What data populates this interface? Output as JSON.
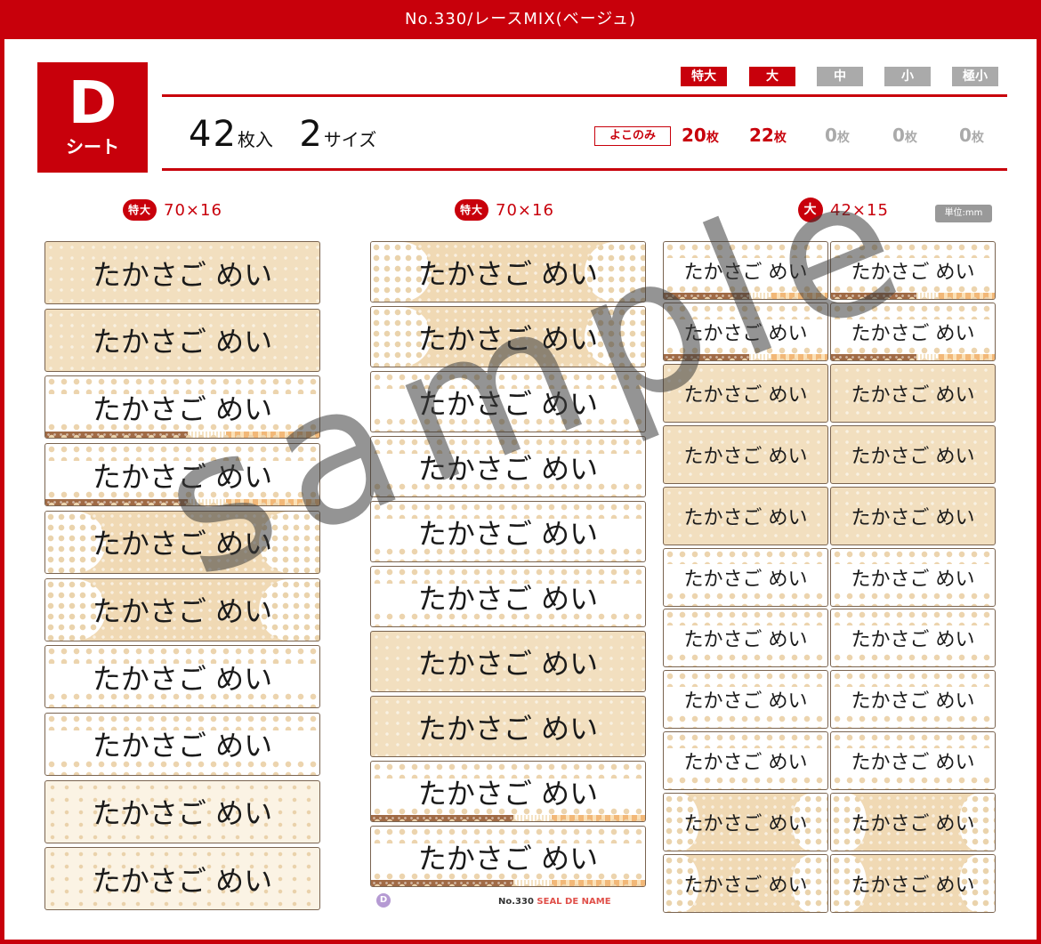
{
  "title": "No.330/レースMIX(ベージュ)",
  "sheet": {
    "letter": "D",
    "word": "シート"
  },
  "sizes": [
    {
      "label": "特大",
      "active": true
    },
    {
      "label": "大",
      "active": true
    },
    {
      "label": "中",
      "active": false
    },
    {
      "label": "小",
      "active": false
    },
    {
      "label": "極小",
      "active": false
    }
  ],
  "summary": {
    "count_num": "42",
    "count_unit": "枚入",
    "sizes_num": "2",
    "sizes_unit": "サイズ"
  },
  "yoko_label": "よこのみ",
  "piece_counts": [
    {
      "num": "20",
      "unit": "枚"
    },
    {
      "num": "22",
      "unit": "枚"
    },
    {
      "num": "0",
      "unit": "枚"
    },
    {
      "num": "0",
      "unit": "枚"
    },
    {
      "num": "0",
      "unit": "枚"
    }
  ],
  "columns": [
    {
      "badge": "特大",
      "dims": "70×16"
    },
    {
      "badge": "特大",
      "dims": "70×16"
    },
    {
      "badge": "大",
      "dims": "42×15"
    }
  ],
  "unit_label": "単位:mm",
  "name": "たかさご めい",
  "watermark": "sample",
  "footer": {
    "badge": "D",
    "model": "No.330",
    "brand": "SEAL DE NAME"
  },
  "colors": {
    "accent": "#c8000b",
    "inactive": "#aaaaaa",
    "beige": "#f2dfbf",
    "brown": "#a06a45"
  },
  "label_patterns": {
    "col1": [
      "beige",
      "beige",
      "white-stripe",
      "white-stripe",
      "lace-side",
      "lace-side",
      "white",
      "white",
      "dots",
      "dots"
    ],
    "col2": [
      "lace-side",
      "lace-side",
      "white",
      "white",
      "white",
      "white",
      "beige",
      "beige",
      "white-stripe",
      "white-stripe"
    ],
    "col3": [
      "white-stripe",
      "white-stripe",
      "beige",
      "beige",
      "beige",
      "white",
      "white",
      "white",
      "white",
      "lace-side",
      "lace-side"
    ]
  }
}
